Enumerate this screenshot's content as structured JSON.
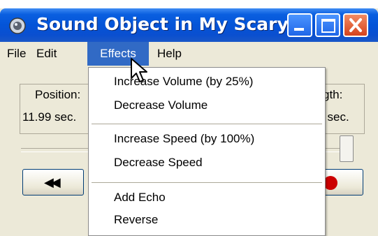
{
  "window": {
    "title": "Sound Object in My Scary...",
    "controls": {
      "minimize": "minimize-icon",
      "maximize": "maximize-icon",
      "close": "close-icon"
    }
  },
  "menubar": {
    "items": [
      "File",
      "Edit",
      "Effects",
      "Help"
    ],
    "active": "Effects"
  },
  "main": {
    "position_label": "Position:",
    "position_value": "11.99 sec.",
    "length_label": "gth:",
    "length_value": "l sec."
  },
  "effects_menu": {
    "items": [
      {
        "label": "Increase Volume (by 25%)"
      },
      {
        "label": "Decrease Volume"
      },
      {
        "label": "Increase Speed (by 100%)"
      },
      {
        "label": "Decrease Speed"
      },
      {
        "label": "Add Echo"
      },
      {
        "label": "Reverse"
      }
    ]
  },
  "colors": {
    "titlebar": "#0454d8",
    "menu_highlight": "#316ac5",
    "face": "#ece9d8",
    "close_button": "#d6431d"
  }
}
